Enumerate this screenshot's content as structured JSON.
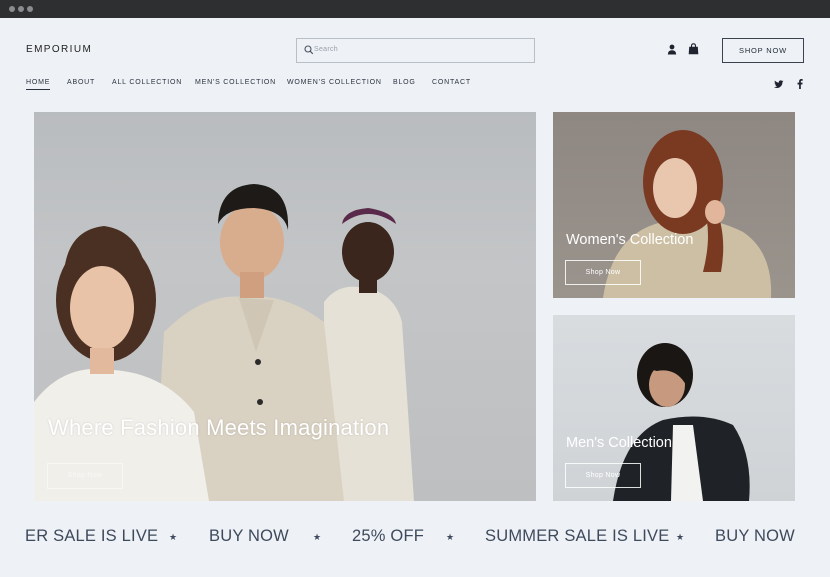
{
  "brand": "EMPORIUM",
  "search": {
    "placeholder": "Search",
    "icon": "search-icon"
  },
  "header": {
    "shop_now_label": "SHOP NOW",
    "icons": [
      "user-icon",
      "shopping-bag-icon"
    ]
  },
  "nav": {
    "items": [
      {
        "label": "HOME",
        "active": true
      },
      {
        "label": "ABOUT"
      },
      {
        "label": "ALL COLLECTION"
      },
      {
        "label": "MEN'S COLLECTION"
      },
      {
        "label": "WOMEN'S COLLECTION"
      },
      {
        "label": "BLOG"
      },
      {
        "label": "CONTACT"
      }
    ],
    "social_icons": [
      "twitter-icon",
      "facebook-icon"
    ]
  },
  "hero": {
    "title": "Where Fashion Meets Imagination",
    "button_label": "Shop Now"
  },
  "cards": {
    "women": {
      "title": "Women's Collection",
      "button_label": "Shop Now"
    },
    "men": {
      "title": "Men's Collection",
      "button_label": "Shop Now"
    }
  },
  "marquee": {
    "items": [
      "ER SALE IS LIVE",
      "BUY NOW",
      "25% OFF",
      "SUMMER SALE IS LIVE",
      "BUY NOW"
    ],
    "separator": "★"
  },
  "colors": {
    "background": "#eef1f5",
    "text": "#1f2a37",
    "marquee_text": "#3e4a5c",
    "titlebar": "#2e2f31"
  }
}
